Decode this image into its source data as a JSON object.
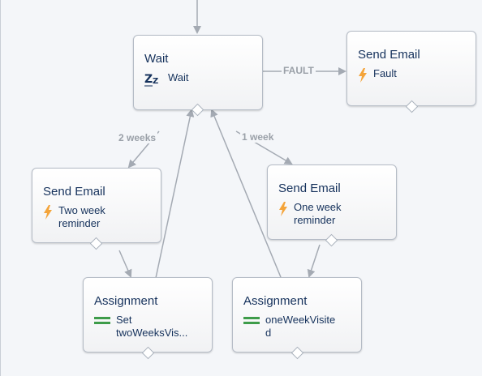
{
  "nodes": {
    "wait": {
      "title": "Wait",
      "label": "Wait"
    },
    "send_fault": {
      "title": "Send Email",
      "label": "Fault"
    },
    "send_two": {
      "title": "Send Email",
      "label": "Two week\nreminder"
    },
    "send_one": {
      "title": "Send Email",
      "label": "One week\nreminder"
    },
    "assign_two": {
      "title": "Assignment",
      "label": "Set\ntwoWeeksVis..."
    },
    "assign_one": {
      "title": "Assignment",
      "label": "oneWeekVisite\nd"
    }
  },
  "edges": {
    "fault": "FAULT",
    "two_weeks": "2 weeks",
    "one_week": "1 week"
  },
  "icons": {
    "wait": "wait-zz-icon",
    "email": "lightning-bolt-icon",
    "assignment": "assignment-equals-icon"
  },
  "colors": {
    "title_text": "#16325c",
    "wire": "#a4aab3",
    "lightning": "#f4a43a",
    "assignment": "#3e9c4a"
  }
}
